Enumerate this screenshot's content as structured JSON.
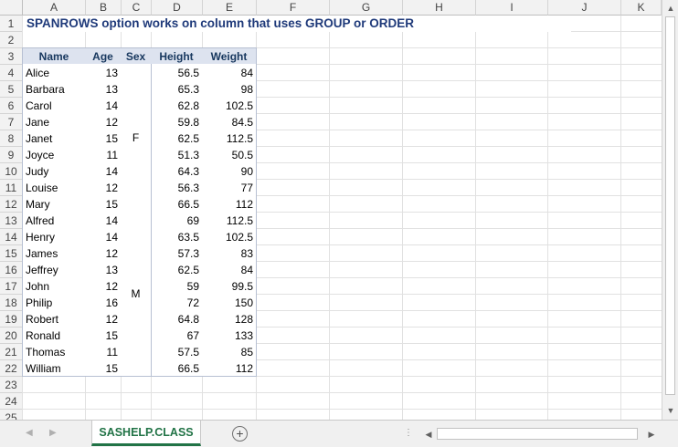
{
  "columns": [
    "A",
    "B",
    "C",
    "D",
    "E",
    "F",
    "G",
    "H",
    "I",
    "J",
    "K"
  ],
  "rows": [
    "1",
    "2",
    "3",
    "4",
    "5",
    "6",
    "7",
    "8",
    "9",
    "10",
    "11",
    "12",
    "13",
    "14",
    "15",
    "16",
    "17",
    "18",
    "19",
    "20",
    "21",
    "22",
    "23",
    "24",
    "25"
  ],
  "title": "SPANROWS option works on column that uses GROUP or ORDER",
  "table": {
    "headers": [
      "Name",
      "Age",
      "Sex",
      "Height",
      "Weight"
    ],
    "rows": [
      [
        "Alice",
        "13",
        "",
        "56.5",
        "84"
      ],
      [
        "Barbara",
        "13",
        "",
        "65.3",
        "98"
      ],
      [
        "Carol",
        "14",
        "",
        "62.8",
        "102.5"
      ],
      [
        "Jane",
        "12",
        "",
        "59.8",
        "84.5"
      ],
      [
        "Janet",
        "15",
        "",
        "62.5",
        "112.5"
      ],
      [
        "Joyce",
        "11",
        "",
        "51.3",
        "50.5"
      ],
      [
        "Judy",
        "14",
        "",
        "64.3",
        "90"
      ],
      [
        "Louise",
        "12",
        "",
        "56.3",
        "77"
      ],
      [
        "Mary",
        "15",
        "",
        "66.5",
        "112"
      ],
      [
        "Alfred",
        "14",
        "",
        "69",
        "112.5"
      ],
      [
        "Henry",
        "14",
        "",
        "63.5",
        "102.5"
      ],
      [
        "James",
        "12",
        "",
        "57.3",
        "83"
      ],
      [
        "Jeffrey",
        "13",
        "",
        "62.5",
        "84"
      ],
      [
        "John",
        "12",
        "",
        "59",
        "99.5"
      ],
      [
        "Philip",
        "16",
        "",
        "72",
        "150"
      ],
      [
        "Robert",
        "12",
        "",
        "64.8",
        "128"
      ],
      [
        "Ronald",
        "15",
        "",
        "67",
        "133"
      ],
      [
        "Thomas",
        "11",
        "",
        "57.5",
        "85"
      ],
      [
        "William",
        "15",
        "",
        "66.5",
        "112"
      ]
    ],
    "sex_groups": [
      "F",
      "M"
    ]
  },
  "sheet_tab": "SASHELP.CLASS",
  "add_sheet": "+"
}
